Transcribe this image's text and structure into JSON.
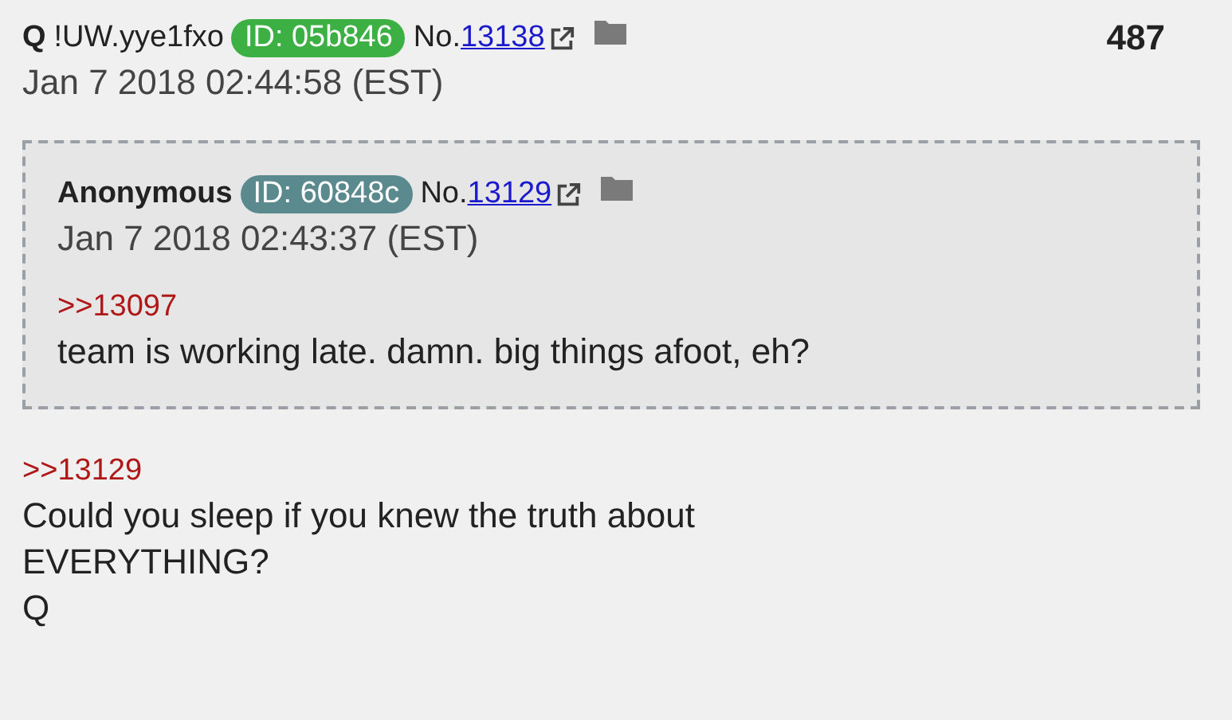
{
  "post": {
    "name": "Q",
    "tripcode": "!UW.yye1fxo",
    "id": {
      "label": "ID: 05b846",
      "color": "#3cb043"
    },
    "no_label": "No.",
    "number": "13138",
    "count": "487",
    "date": "Jan 7 2018 02:44:58 (EST)",
    "quoted_post": {
      "name": "Anonymous",
      "id": {
        "label": "ID: 60848c",
        "color": "#5b8a8e"
      },
      "no_label": "No.",
      "number": "13129",
      "date": "Jan 7 2018 02:43:37 (EST)",
      "reply_link": ">>13097",
      "message": "team is working late. damn. big things afoot, eh?"
    },
    "reply_link": ">>13129",
    "message": "Could you sleep if you knew the truth about\nEVERYTHING?\nQ"
  }
}
